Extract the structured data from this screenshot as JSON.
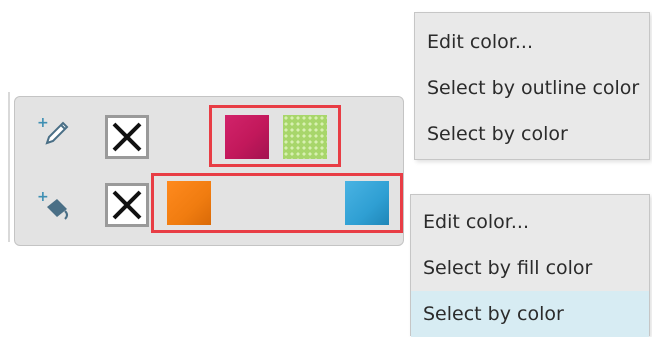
{
  "outline_row": {
    "none_icon": "close-icon",
    "tool_icon": "pen-icon",
    "swatches": [
      {
        "color": "#c2185b",
        "pattern": "crimson"
      },
      {
        "color": "#a8d66b",
        "pattern": "light-green-dotted"
      }
    ]
  },
  "fill_row": {
    "none_icon": "close-icon",
    "tool_icon": "paint-bucket-icon",
    "swatches": [
      {
        "color": "#f07c10",
        "pattern": "orange"
      },
      {
        "color": "#2f9fd3",
        "pattern": "sky-blue"
      }
    ]
  },
  "outline_context_menu": {
    "items": [
      "Edit color...",
      "Select by outline color",
      "Select by color"
    ]
  },
  "fill_context_menu": {
    "items": [
      "Edit color...",
      "Select by fill color",
      "Select by color"
    ],
    "highlighted_index": 2
  },
  "colors": {
    "highlight_border": "#e83d45",
    "hover_background": "#d7ecf3",
    "panel_background": "#e3e3e3",
    "icon_color": "#3f8fb3"
  }
}
